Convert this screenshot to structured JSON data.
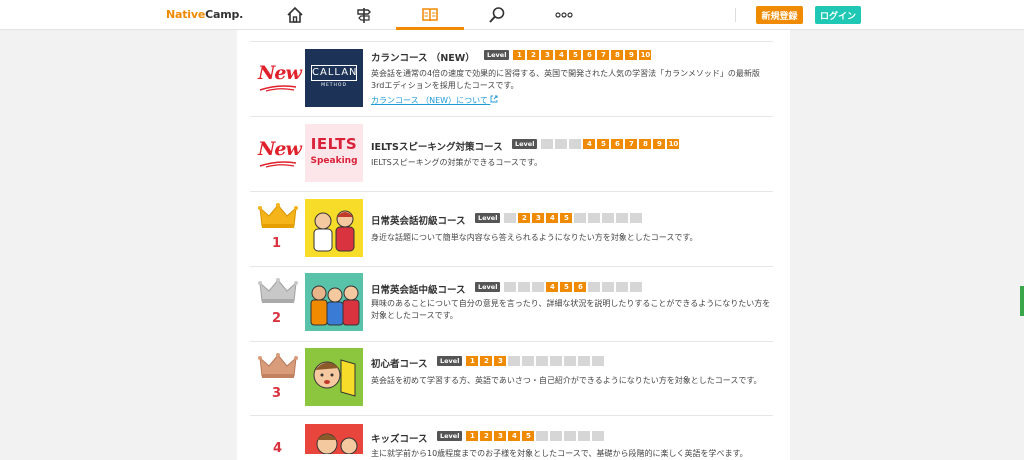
{
  "header": {
    "logo_text": "Native",
    "logo_text2": "Camp.",
    "nav": [
      {
        "icon": "home-icon"
      },
      {
        "icon": "signpost-icon"
      },
      {
        "icon": "book-icon"
      },
      {
        "icon": "search-icon"
      },
      {
        "icon": "more-icon"
      }
    ],
    "signup_label": "新規登録",
    "login_label": "ログイン"
  },
  "colors": {
    "accent": "#f08a00",
    "login": "#1fc8b4",
    "rank_red": "#d9333f",
    "new_red": "#e0202a"
  },
  "courses": [
    {
      "badge": "new",
      "new_label": "New",
      "title": "カランコース （NEW）",
      "level_label": "Level",
      "levels": [
        1,
        1,
        1,
        1,
        1,
        1,
        1,
        1,
        1,
        1
      ],
      "desc": "英会話を通常の4倍の速度で効果的に習得する、英国で開発された人気の学習法「カランメソッド」の最新版3rdエディションを採用したコースです。",
      "link": "カランコース （NEW）について",
      "thumb_text": "CALLAN",
      "thumb_sub": "METHOD"
    },
    {
      "badge": "new",
      "new_label": "New",
      "title": "IELTSスピーキング対策コース",
      "level_label": "Level",
      "levels": [
        0,
        0,
        0,
        1,
        1,
        1,
        1,
        1,
        1,
        1
      ],
      "desc": "IELTSスピーキングの対策ができるコースです。",
      "thumb_text": "IELTS",
      "thumb_sub": "Speaking"
    },
    {
      "badge": "gold",
      "rank": "1",
      "title": "日常英会話初級コース",
      "level_label": "Level",
      "levels": [
        0,
        1,
        1,
        1,
        1,
        0,
        0,
        0,
        0,
        0
      ],
      "desc": "身近な話題について簡単な内容なら答えられるようになりたい方を対象としたコースです。"
    },
    {
      "badge": "silver",
      "rank": "2",
      "title": "日常英会話中級コース",
      "level_label": "Level",
      "levels": [
        0,
        0,
        0,
        1,
        1,
        1,
        0,
        0,
        0,
        0
      ],
      "desc": "興味のあることについて自分の意見を言ったり、詳細な状況を説明したりすることができるようになりたい方を対象としたコースです。"
    },
    {
      "badge": "bronze",
      "rank": "3",
      "title": "初心者コース",
      "level_label": "Level",
      "levels": [
        1,
        1,
        1,
        0,
        0,
        0,
        0,
        0,
        0,
        0
      ],
      "desc": "英会話を初めて学習する方、英語であいさつ・自己紹介ができるようになりたい方を対象としたコースです。"
    },
    {
      "badge": "rank",
      "rank": "4",
      "title": "キッズコース",
      "level_label": "Level",
      "levels": [
        1,
        1,
        1,
        1,
        1,
        0,
        0,
        0,
        0,
        0
      ],
      "desc": "主に就学前から10歳程度までのお子様を対象としたコースで、基礎から段階的に楽しく英語を学べます。"
    }
  ]
}
